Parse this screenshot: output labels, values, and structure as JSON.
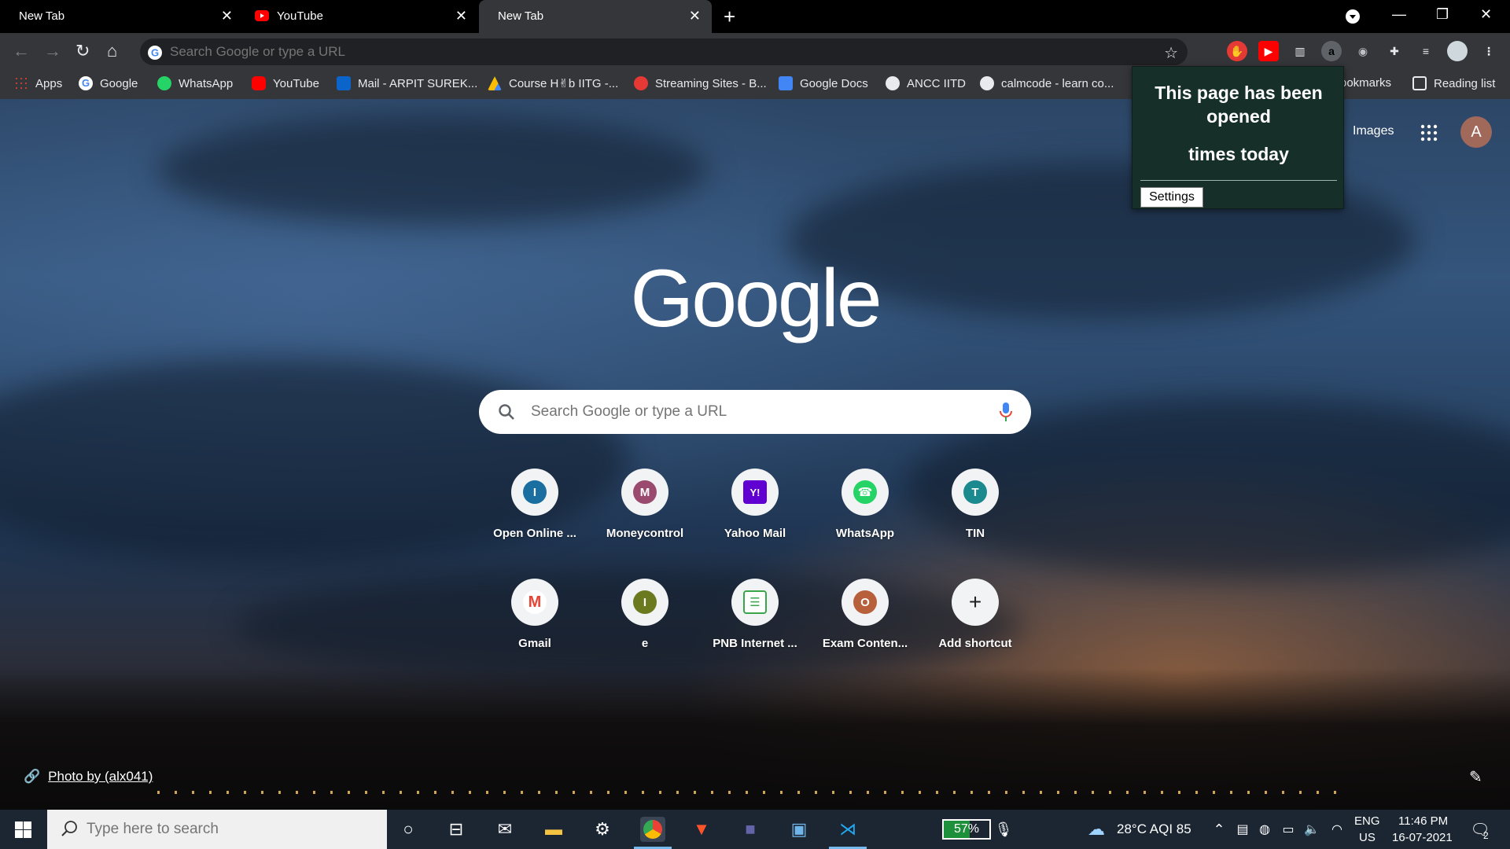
{
  "tabs": [
    {
      "title": "New Tab",
      "active": false
    },
    {
      "title": "YouTube",
      "active": false,
      "icon": "youtube-icon"
    },
    {
      "title": "New Tab",
      "active": true
    }
  ],
  "toolbar": {
    "omnibox_placeholder": "Search Google or type a URL"
  },
  "bookmarks": [
    {
      "label": "Apps",
      "icon": "apps-grid-icon"
    },
    {
      "label": "Google",
      "icon": "google-icon"
    },
    {
      "label": "WhatsApp",
      "icon": "whatsapp-icon"
    },
    {
      "label": "YouTube",
      "icon": "youtube-icon"
    },
    {
      "label": "Mail - ARPIT SUREK...",
      "icon": "outlook-icon"
    },
    {
      "label": "Course H✌b IITG -...",
      "icon": "drive-icon"
    },
    {
      "label": "Streaming Sites - B...",
      "icon": "streaming-icon"
    },
    {
      "label": "Google Docs",
      "icon": "docs-icon"
    },
    {
      "label": "ANCC IITD",
      "icon": "globe-icon"
    },
    {
      "label": "calmcode - learn co...",
      "icon": "calmcode-icon"
    },
    {
      "label": "ookmarks",
      "icon": "folder-icon"
    },
    {
      "label": "Reading list",
      "icon": "reading-list-icon"
    }
  ],
  "ntp": {
    "logo": "Google",
    "search_placeholder": "Search Google or type a URL",
    "images_link": "Images",
    "avatar_letter": "A",
    "shortcuts": [
      {
        "label": "Open Online ...",
        "letter": "I",
        "color": "#1a6fa0"
      },
      {
        "label": "Moneycontrol",
        "letter": "M",
        "color": "#9a4a6f"
      },
      {
        "label": "Yahoo Mail",
        "letter": "Y!",
        "color": "#6001d2"
      },
      {
        "label": "WhatsApp",
        "letter": "☎",
        "color": "#25d366"
      },
      {
        "label": "TIN",
        "letter": "T",
        "color": "#1b8a8f"
      },
      {
        "label": "Gmail",
        "letter": "M",
        "color": "#ea4335"
      },
      {
        "label": "e",
        "letter": "I",
        "color": "#6b7a1f"
      },
      {
        "label": "PNB Internet ...",
        "letter": "☰",
        "color": "#3aa64a"
      },
      {
        "label": "Exam Conten...",
        "letter": "O",
        "color": "#b8603b"
      },
      {
        "label": "Add shortcut",
        "letter": "+",
        "color": "#f1f3f4"
      }
    ],
    "photo_credit": "Photo by (alx041)"
  },
  "popup": {
    "line1": "This page has been",
    "line2": "opened",
    "line3": "times today",
    "settings_label": "Settings"
  },
  "taskbar": {
    "search_placeholder": "Type here to search",
    "battery": "57%",
    "weather": "28°C  AQI 85",
    "lang_top": "ENG",
    "lang_bottom": "US",
    "time": "11:46 PM",
    "date": "16-07-2021",
    "notifications": "2"
  },
  "colors": {
    "tabbar": "#000000",
    "toolbar": "#35363a",
    "popup_bg": "#163029",
    "taskbar": "#1c2633"
  }
}
